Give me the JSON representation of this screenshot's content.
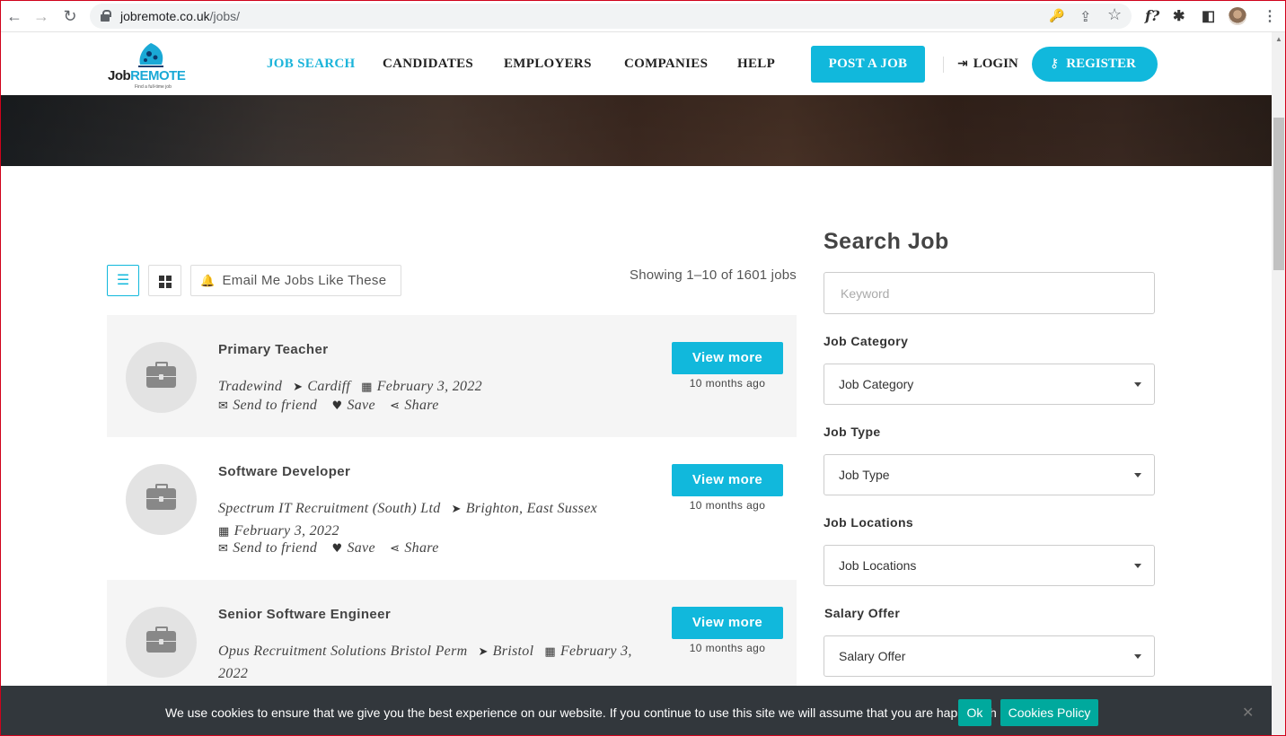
{
  "browser": {
    "url_domain": "jobremote.co.uk",
    "url_path": "/jobs/",
    "back_icon": "←",
    "forward_icon": "→",
    "reload_icon": "↻",
    "key_icon": "🔑",
    "share_icon": "⇪",
    "star_icon": "☆",
    "ext_label": "f?",
    "puzzle_icon": "✱",
    "sidebar_icon": "◧",
    "menu_icon": "⋮"
  },
  "site": {
    "logo_text_a": "Job",
    "logo_text_b": "REMOTE",
    "logo_tagline": "Find a full-time job",
    "brand_color": "#11b8dc"
  },
  "nav": {
    "items": [
      {
        "label": "JOB SEARCH",
        "active": true
      },
      {
        "label": "CANDIDATES"
      },
      {
        "label": "EMPLOYERS"
      },
      {
        "label": "COMPANIES"
      },
      {
        "label": "HELP"
      }
    ],
    "post_job": "POST A JOB",
    "login": "LOGIN",
    "register": "REGISTER"
  },
  "toolbar": {
    "list_icon": "☰",
    "email_alert": "Email Me Jobs Like These",
    "showing": "Showing 1–10 of 1601 jobs"
  },
  "jobs": [
    {
      "title": "Primary Teacher",
      "company": "Tradewind",
      "location": "Cardiff",
      "date": "February 3, 2022",
      "view": "View more",
      "posted": "10 months ago"
    },
    {
      "title": "Software Developer",
      "company": "Spectrum IT Recruitment (South) Ltd",
      "location": "Brighton, East Sussex",
      "date": "February 3, 2022",
      "view": "View more",
      "posted": "10 months ago"
    },
    {
      "title": "Senior Software Engineer",
      "company": "Opus Recruitment Solutions Bristol Perm",
      "location": "Bristol",
      "date": "February 3, 2022",
      "view": "View more",
      "posted": "10 months ago"
    }
  ],
  "job_actions": {
    "send": "Send to friend",
    "save": "Save",
    "share": "Share"
  },
  "sidebar": {
    "title": "Search Job",
    "keyword_placeholder": "Keyword",
    "fields": [
      {
        "label": "Job Category",
        "value": "Job Category"
      },
      {
        "label": "Job Type",
        "value": "Job Type"
      },
      {
        "label": "Job Locations",
        "value": "Job Locations"
      },
      {
        "label": "Salary Offer",
        "value": "Salary Offer"
      }
    ]
  },
  "cookie": {
    "text": "We use cookies to ensure that we give you the best experience on our website. If you continue to use this site we will assume that you are happy with it.",
    "ok": "Ok",
    "policy": "Cookies Policy",
    "close": "✕"
  }
}
